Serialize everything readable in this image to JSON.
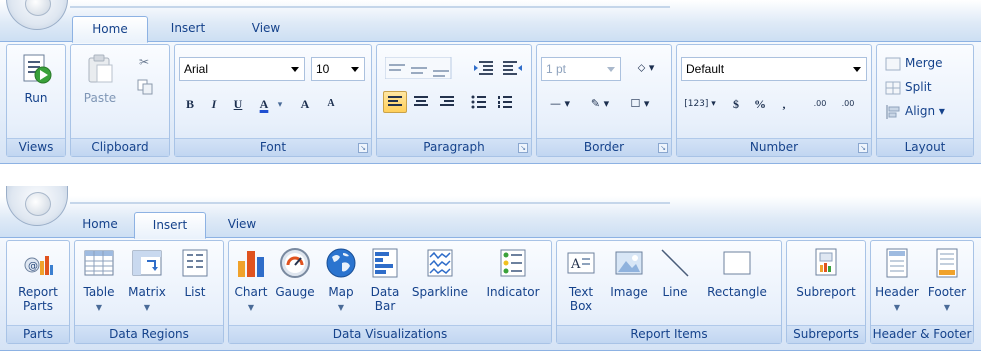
{
  "ribbon1": {
    "tabs": [
      {
        "label": "Home"
      },
      {
        "label": "Insert"
      },
      {
        "label": "View"
      }
    ],
    "active_tab": "Home",
    "groups": {
      "views": {
        "label": "Views",
        "run": "Run"
      },
      "clipboard": {
        "label": "Clipboard",
        "paste": "Paste"
      },
      "font": {
        "label": "Font",
        "family": "Arial",
        "size": "10",
        "bold": "B",
        "italic": "I",
        "underline": "U",
        "color": "A",
        "grow": "A",
        "shrink": "A"
      },
      "paragraph": {
        "label": "Paragraph"
      },
      "border": {
        "label": "Border",
        "width": "1 pt"
      },
      "number": {
        "label": "Number",
        "format": "Default",
        "placeholder": "[123]",
        "currency": "$",
        "percent": "%",
        "comma": ",",
        "inc": ".00",
        "dec": ".00"
      },
      "layout": {
        "label": "Layout",
        "merge": "Merge",
        "split": "Split",
        "align": "Align"
      }
    }
  },
  "ribbon2": {
    "tabs": [
      {
        "label": "Home"
      },
      {
        "label": "Insert"
      },
      {
        "label": "View"
      }
    ],
    "active_tab": "Insert",
    "groups": {
      "parts": {
        "label": "Parts",
        "report_parts": "Report",
        "report_parts2": "Parts"
      },
      "data_regions": {
        "label": "Data Regions",
        "table": "Table",
        "matrix": "Matrix",
        "list": "List"
      },
      "data_viz": {
        "label": "Data Visualizations",
        "chart": "Chart",
        "gauge": "Gauge",
        "map": "Map",
        "databar1": "Data",
        "databar2": "Bar",
        "sparkline": "Sparkline",
        "indicator": "Indicator"
      },
      "report_items": {
        "label": "Report Items",
        "textbox1": "Text",
        "textbox2": "Box",
        "image": "Image",
        "line": "Line",
        "rectangle": "Rectangle"
      },
      "subreports": {
        "label": "Subreports",
        "subreport": "Subreport"
      },
      "header_footer": {
        "label": "Header & Footer",
        "header": "Header",
        "footer": "Footer"
      }
    }
  },
  "colors": {
    "accent": "#15428b",
    "border": "#8db2e3",
    "selected": "#ffcf5a"
  }
}
